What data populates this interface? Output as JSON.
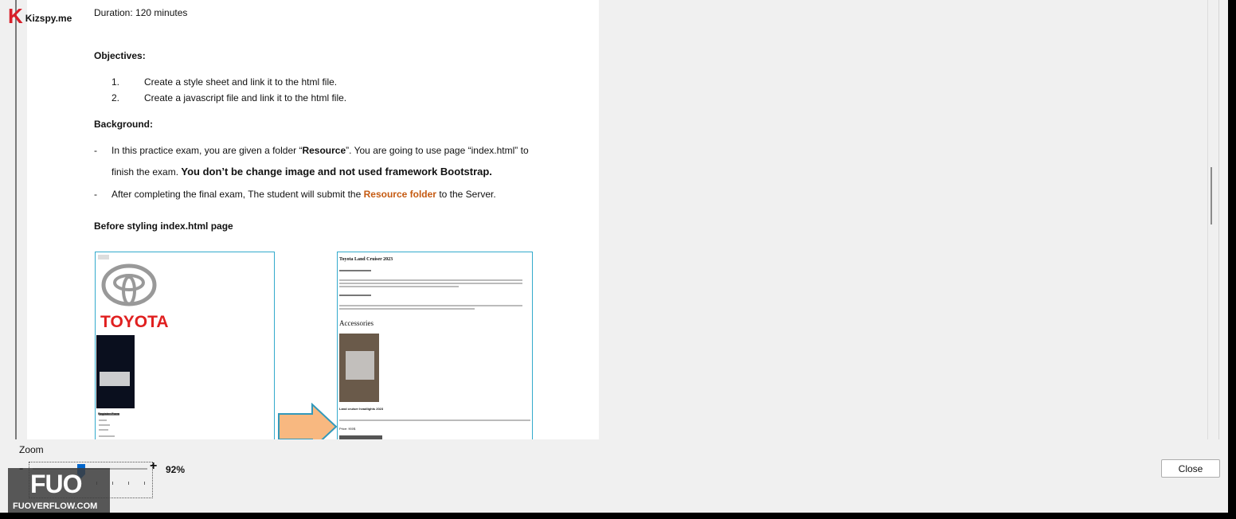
{
  "brand": {
    "name": "Kizspy.me"
  },
  "document": {
    "duration": "Duration: 120 minutes",
    "objectives_heading": "Objectives:",
    "objectives": [
      {
        "num": "1.",
        "text": "Create a style sheet and link it to the html file."
      },
      {
        "num": "2.",
        "text": "Create a javascript file and link it to the html file."
      }
    ],
    "background_heading": "Background:",
    "bg1_prefix": "In this practice exam, you are given a folder “",
    "bg1_bold": "Resource",
    "bg1_suffix": "”. You are going to use page “index.html”  to",
    "bg2_line": "finish the exam.",
    "bg2_bold": "You don’t be change image and not used framework Bootstrap.",
    "bg3_prefix": "After completing the final exam, The student will submit the",
    "bg3_orange": "Resource folder",
    "bg3_suffix": "to the Server.",
    "before_heading": "Before styling index.html page",
    "thumb_left": {
      "toyota_word": "TOYOTA",
      "caption": "Register Form"
    },
    "thumb_right": {
      "title": "Toyota Land Cruiser 2023",
      "accessories": "Accessories",
      "caption": "Land cruiser headlights 2023",
      "price": "Price: 900$"
    }
  },
  "zoom": {
    "label": "Zoom",
    "minus": "-",
    "plus": "+",
    "value": "92%",
    "level_percent": 92
  },
  "buttons": {
    "close": "Close"
  },
  "watermark": {
    "logo": "FUO",
    "text": "FUOVERFLOW.COM"
  },
  "colors": {
    "accent_orange": "#c55a11",
    "slider_thumb": "#0066cc",
    "toyota_red": "#e02020",
    "thumb_border": "#33aacc",
    "arrow_fill": "#f8b880"
  }
}
